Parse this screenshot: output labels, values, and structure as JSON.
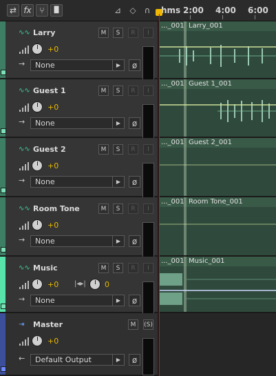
{
  "toolbar": {
    "buttons": [
      {
        "name": "swap-icon",
        "glyph": "⇄"
      },
      {
        "name": "fx-icon",
        "glyph": "fx"
      },
      {
        "name": "branch-icon",
        "glyph": "⑂"
      },
      {
        "name": "bars-icon",
        "glyph": "▐▌"
      }
    ],
    "right_icons": [
      {
        "name": "metronome-icon",
        "glyph": "⊿"
      },
      {
        "name": "keyframe-icon",
        "glyph": "◇"
      },
      {
        "name": "headphones-icon",
        "glyph": "∩"
      }
    ]
  },
  "ruler": {
    "labels": [
      "hms",
      "2:00",
      "4:00",
      "6:00"
    ]
  },
  "tracks": [
    {
      "name": "Larry",
      "volume": "+0",
      "output": "None",
      "clip_a": "..._001",
      "clip_b": "Larry_001",
      "mute": "M",
      "solo": "S",
      "rec": "R",
      "input": "I"
    },
    {
      "name": "Guest 1",
      "volume": "+0",
      "output": "None",
      "clip_a": "..._001",
      "clip_b": "Guest 1_001",
      "mute": "M",
      "solo": "S",
      "rec": "R",
      "input": "I"
    },
    {
      "name": "Guest 2",
      "volume": "+0",
      "output": "None",
      "clip_a": "..._001",
      "clip_b": "Guest 2_001",
      "mute": "M",
      "solo": "S",
      "rec": "R",
      "input": "I"
    },
    {
      "name": "Room Tone",
      "volume": "+0",
      "output": "None",
      "clip_a": "..._001",
      "clip_b": "Room Tone_001",
      "mute": "M",
      "solo": "S",
      "rec": "R",
      "input": "I"
    },
    {
      "name": "Music",
      "volume": "+0",
      "pan": "0",
      "output": "None",
      "clip_a": "..._001",
      "clip_b": "Music_001",
      "mute": "M",
      "solo": "S",
      "rec": "R",
      "input": "I"
    }
  ],
  "master": {
    "name": "Master",
    "volume": "+0",
    "output": "Default Output",
    "mute": "M",
    "solo": "(S)"
  },
  "colors": {
    "accent_green": "#3fd29a",
    "volume_yellow": "#e8b800",
    "playhead_red": "#b12020",
    "master_blue": "#4a63c8"
  }
}
